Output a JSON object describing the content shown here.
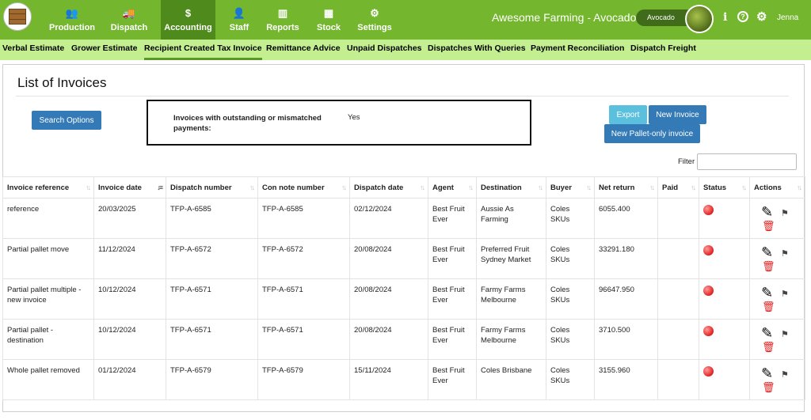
{
  "nav": {
    "items": [
      {
        "label": "Production",
        "icon": "users-icon",
        "glyph": "👥"
      },
      {
        "label": "Dispatch",
        "icon": "truck-icon",
        "glyph": "🚚"
      },
      {
        "label": "Accounting",
        "icon": "dollar-icon",
        "glyph": "$"
      },
      {
        "label": "Staff",
        "icon": "person-icon",
        "glyph": "👤"
      },
      {
        "label": "Reports",
        "icon": "columns-icon",
        "glyph": "▥"
      },
      {
        "label": "Stock",
        "icon": "grid-icon",
        "glyph": "▦"
      },
      {
        "label": "Settings",
        "icon": "gear-icon",
        "glyph": "⚙"
      }
    ]
  },
  "header": {
    "app_title": "Awesome Farming - Avocados",
    "farm_badge": "Avocado",
    "user": "Jenna"
  },
  "subnav": {
    "items": [
      "Verbal Estimate",
      "Grower Estimate",
      "Recipient Created Tax Invoice",
      "Remittance Advice",
      "Unpaid Dispatches",
      "Dispatches With Queries",
      "Payment Reconciliation",
      "Dispatch Freight"
    ],
    "active": "Recipient Created Tax Invoice"
  },
  "page": {
    "title": "List of Invoices",
    "search_button": "Search Options",
    "outstanding_label": "Invoices with outstanding or mismatched payments:",
    "outstanding_value": "Yes",
    "export_button": "Export",
    "new_invoice_button": "New Invoice",
    "new_pallet_button": "New Pallet-only invoice",
    "filter_label": "Filter"
  },
  "table": {
    "columns": [
      "Invoice reference",
      "Invoice date",
      "Dispatch number",
      "Con note number",
      "Dispatch date",
      "Agent",
      "Destination",
      "Buyer",
      "Net return",
      "Paid",
      "Status",
      "Actions"
    ],
    "rows": [
      [
        "reference",
        "20/03/2025",
        "TFP-A-6585",
        "TFP-A-6585",
        "02/12/2024",
        "Best Fruit Ever",
        "Aussie As Farming",
        "Coles SKUs",
        "6055.400",
        ""
      ],
      [
        "Partial pallet move",
        "11/12/2024",
        "TFP-A-6572",
        "TFP-A-6572",
        "20/08/2024",
        "Best Fruit Ever",
        "Preferred Fruit Sydney Market",
        "Coles SKUs",
        "33291.180",
        ""
      ],
      [
        "Partial pallet multiple - new invoice",
        "10/12/2024",
        "TFP-A-6571",
        "TFP-A-6571",
        "20/08/2024",
        "Best Fruit Ever",
        "Farmy Farms Melbourne",
        "Coles SKUs",
        "96647.950",
        ""
      ],
      [
        "Partial pallet - destination",
        "10/12/2024",
        "TFP-A-6571",
        "TFP-A-6571",
        "20/08/2024",
        "Best Fruit Ever",
        "Farmy Farms Melbourne",
        "Coles SKUs",
        "3710.500",
        ""
      ],
      [
        "Whole pallet removed",
        "01/12/2024",
        "TFP-A-6579",
        "TFP-A-6579",
        "15/11/2024",
        "Best Fruit Ever",
        "Coles Brisbane",
        "Coles SKUs",
        "3155.960",
        ""
      ]
    ]
  },
  "colors": {
    "topbar": "#74b72e",
    "topbar_active": "#4e8a1c",
    "subnav": "#c3ef91",
    "primary_button": "#337ab7",
    "export_button": "#5bc0de",
    "status_red": "#e02020",
    "trash_red": "#e01c1c"
  }
}
